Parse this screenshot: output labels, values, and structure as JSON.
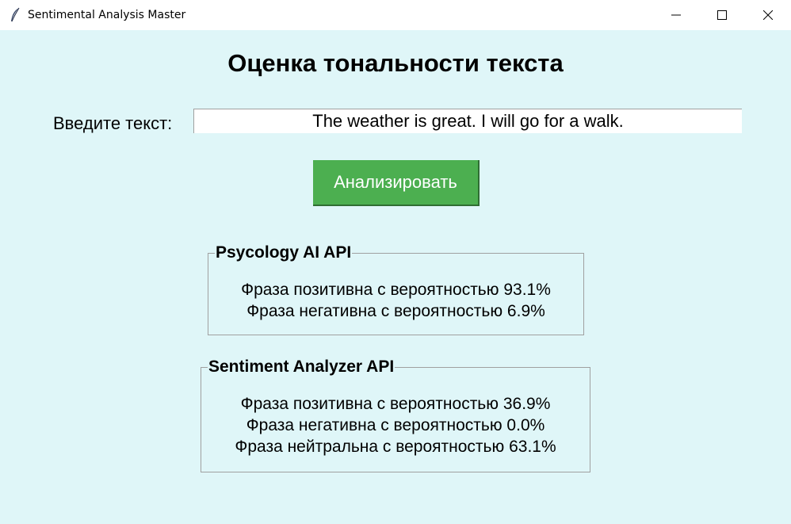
{
  "window": {
    "title": "Sentimental Analysis Master"
  },
  "main": {
    "heading": "Оценка тональности текста",
    "input_label": "Введите текст:",
    "input_value": "The weather is great. I will go for a walk.",
    "analyze_button": "Анализировать"
  },
  "results": {
    "psychology_api": {
      "title": "Psycology AI API",
      "lines": [
        "Фраза позитивна с вероятностью 93.1%",
        "Фраза негативна с вероятностью 6.9%"
      ]
    },
    "sentiment_analyzer_api": {
      "title": "Sentiment Analyzer API",
      "lines": [
        "Фраза позитивна с вероятностью 36.9%",
        "Фраза негативна с вероятностью 0.0%",
        "Фраза нейтральна с вероятностью 63.1%"
      ]
    }
  },
  "colors": {
    "background": "#dff6f8",
    "button": "#4caf50",
    "button_text": "#ffffff"
  },
  "icons": {
    "app": "feather-icon",
    "minimize": "minimize-icon",
    "maximize": "maximize-icon",
    "close": "close-icon"
  }
}
